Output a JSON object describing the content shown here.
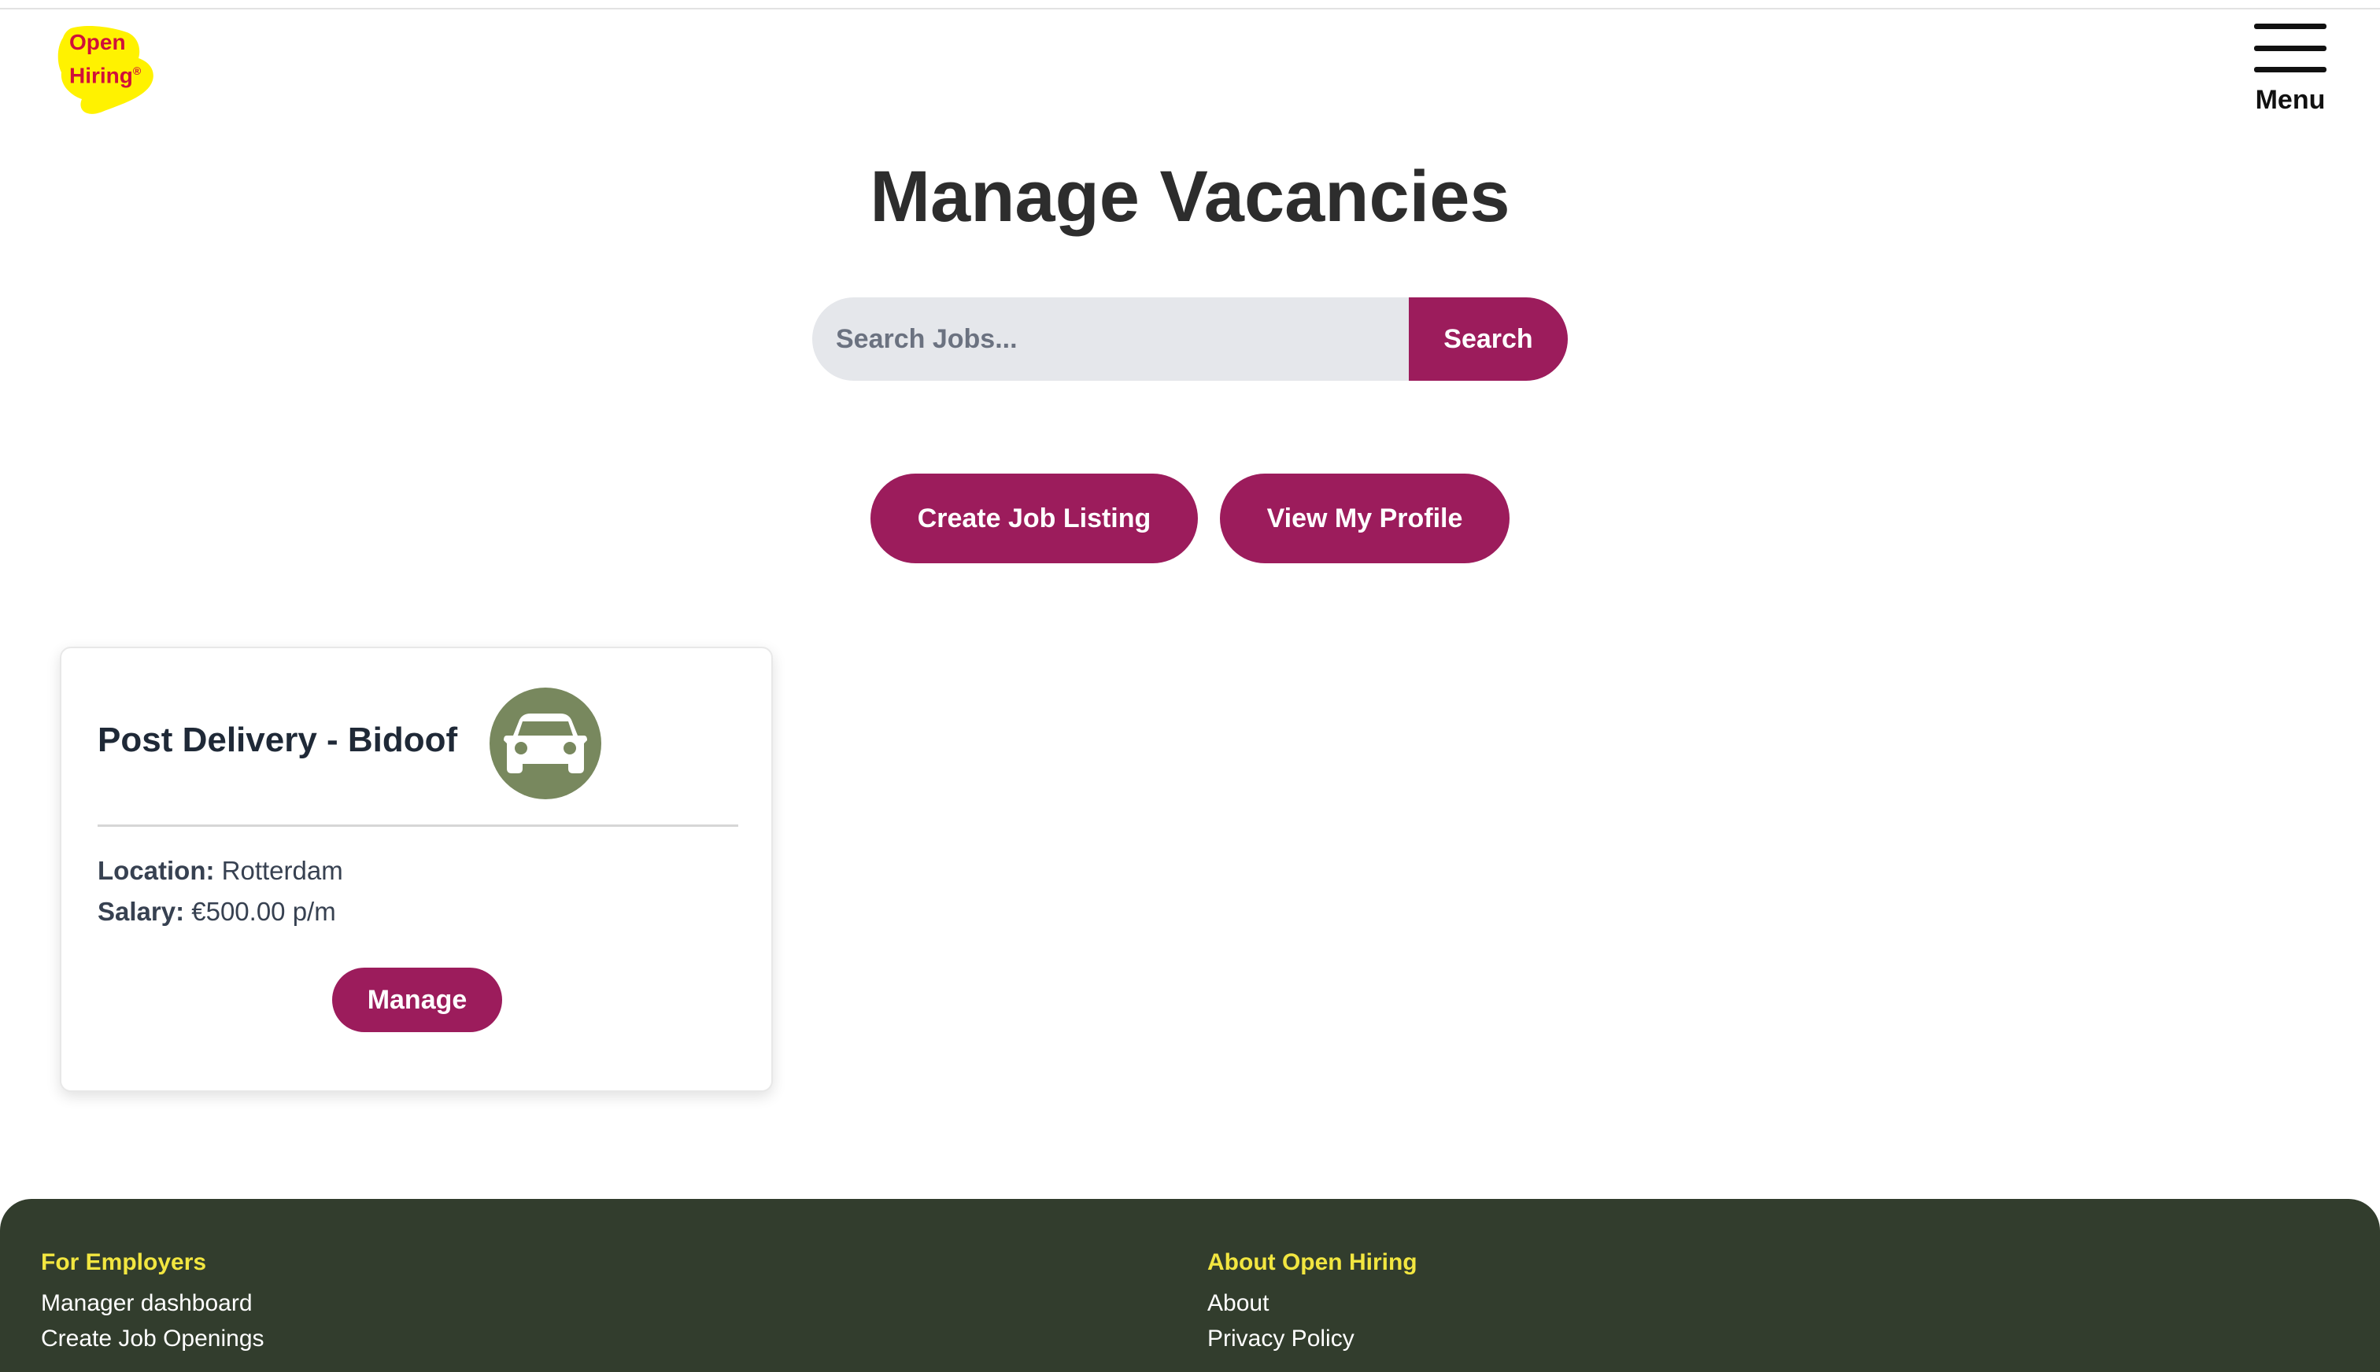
{
  "logo": {
    "line1": "Open",
    "line2": "Hiring",
    "mark": "®"
  },
  "menu": {
    "label": "Menu",
    "icon": "hamburger-icon"
  },
  "page": {
    "title": "Manage Vacancies"
  },
  "search": {
    "placeholder": "Search Jobs...",
    "button_label": "Search"
  },
  "actions": {
    "create_label": "Create Job Listing",
    "profile_label": "View My Profile"
  },
  "job": {
    "title": "Post Delivery - Bidoof",
    "icon": "car-icon",
    "location_label": "Location:",
    "location_value": "Rotterdam",
    "salary_label": "Salary:",
    "salary_value": "€500.00 p/m",
    "manage_label": "Manage"
  },
  "footer": {
    "col1": {
      "heading": "For Employers",
      "links": [
        "Manager dashboard",
        "Create Job Openings"
      ]
    },
    "col2": {
      "heading": "About Open Hiring",
      "links": [
        "About",
        "Privacy Policy"
      ]
    }
  },
  "colors": {
    "brand": "#9c1c5c",
    "footer_bg": "#323d2d",
    "footer_heading": "#f2e640",
    "logo_yellow": "#fff200",
    "logo_red": "#d0103a",
    "icon_bg": "#78885e"
  }
}
